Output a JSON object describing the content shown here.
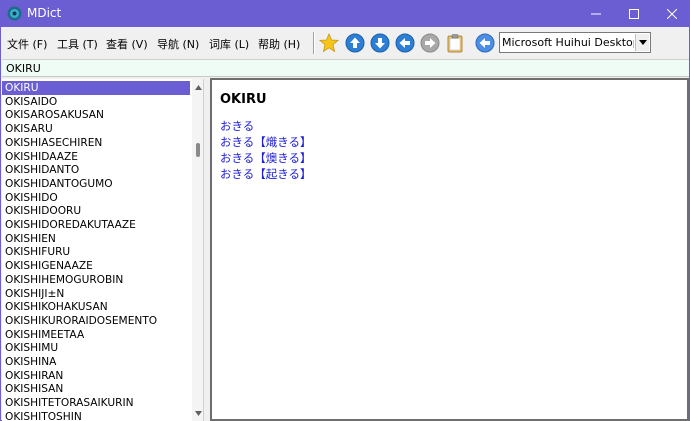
{
  "window": {
    "title": "MDict"
  },
  "menu": [
    {
      "label": "文件 (F)"
    },
    {
      "label": "工具 (T)"
    },
    {
      "label": "查看 (V)"
    },
    {
      "label": "导航 (N)"
    },
    {
      "label": "词库 (L)"
    },
    {
      "label": "帮助 (H)"
    }
  ],
  "toolbar": {
    "icons": [
      "star-icon",
      "arrow-up-icon",
      "arrow-down-icon",
      "arrow-back-icon",
      "arrow-forward-icon",
      "clipboard-icon",
      "audio-back-icon"
    ],
    "dictionary_select": "Microsoft Huihui Desktop -"
  },
  "search": {
    "value": "OKIRU"
  },
  "word_list": {
    "selected_index": 0,
    "items": [
      "OKIRU",
      "OKISAIDO",
      "OKISAROSAKUSAN",
      "OKISARU",
      "OKISHIASECHIREN",
      "OKISHIDAAZE",
      "OKISHIDANTO",
      "OKISHIDANTOGUMO",
      "OKISHIDO",
      "OKISHIDOORU",
      "OKISHIDOREDAKUTAAZE",
      "OKISHIEN",
      "OKISHIFURU",
      "OKISHIGENAAZE",
      "OKISHIHEMOGUROBIN",
      "OKISHIJI±N",
      "OKISHIKOHAKUSAN",
      "OKISHIKURORAIDOSEMENTO",
      "OKISHIMEETAA",
      "OKISHIMU",
      "OKISHINA",
      "OKISHIRAN",
      "OKISHISAN",
      "OKISHITETORASAIKURIN",
      "OKISHITOSHIN"
    ]
  },
  "entry": {
    "headword": "OKIRU",
    "links": [
      "おきる",
      "おきる【熾きる】",
      "おきる【燠きる】",
      "おきる【起きる】"
    ]
  },
  "colors": {
    "titlebar": "#6a5ed2",
    "selection": "#6a5ed2",
    "link": "#2020d8",
    "search_bg": "#eefcf5"
  }
}
